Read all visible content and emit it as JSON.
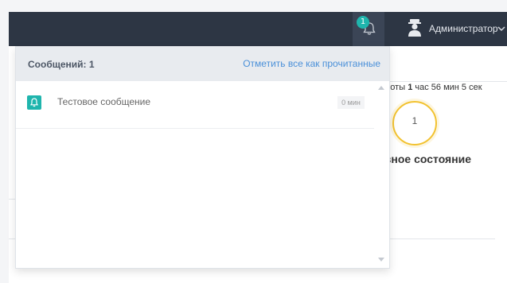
{
  "topbar": {
    "notification_count": "1",
    "user_name": "Администратор"
  },
  "background": {
    "uptime_prefix": "боты ",
    "uptime_hours": "1",
    "uptime_rest": " час 56 мин 5 сек",
    "ring_value": "1",
    "state_text": "авное состояние"
  },
  "dropdown": {
    "count_label": "Сообщений: 1",
    "mark_all_label": "Отметить все как прочитанные",
    "messages": [
      {
        "text": "Тестовое сообщение",
        "time": "0 мин"
      }
    ]
  },
  "colors": {
    "topbar": "#2d3644",
    "accent": "#1fb5ad",
    "link": "#4a90d9",
    "ring": "#f2c230"
  }
}
